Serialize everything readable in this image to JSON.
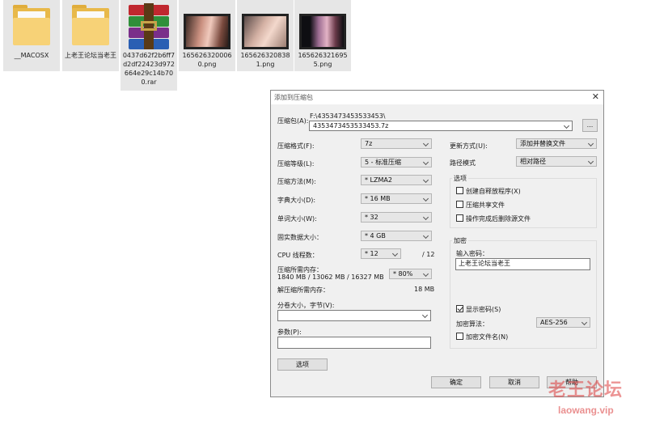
{
  "desktop": {
    "files": [
      {
        "name": "__MACOSX",
        "type": "folder-icon"
      },
      {
        "name": "上老王论坛当老王",
        "type": "folder-icon"
      },
      {
        "name": "0437d62f2b6ff7d2df22423d972664e29c14b700.rar",
        "type": "winrar-archive-icon"
      },
      {
        "name": "1656263200060.png",
        "type": "image-thumbnail"
      },
      {
        "name": "1656263208381.png",
        "type": "image-thumbnail"
      },
      {
        "name": "1656263216955.png",
        "type": "image-thumbnail"
      }
    ]
  },
  "dialog": {
    "title": "添加到压缩包",
    "close_glyph": "✕",
    "archive": {
      "label": "压缩包(A):",
      "path": "F:\\4353473453533453\\",
      "name": "4353473453533453.7z",
      "browse_label": "..."
    },
    "left": {
      "format": {
        "label": "压缩格式(F):",
        "value": "7z"
      },
      "level": {
        "label": "压缩等级(L):",
        "value": "5 - 标准压缩"
      },
      "method": {
        "label": "压缩方法(M):",
        "value": "* LZMA2"
      },
      "dict": {
        "label": "字典大小(D):",
        "value": "* 16 MB"
      },
      "word": {
        "label": "单词大小(W):",
        "value": "* 32"
      },
      "solid": {
        "label": "固实数据大小：",
        "value": "* 4 GB"
      },
      "cpu": {
        "label": "CPU 线程数：",
        "value": "* 12",
        "max": "/ 12"
      },
      "memory": {
        "label": "压缩所需内存：",
        "detail": "1840 MB / 13062 MB / 16327 MB",
        "percent": "* 80%"
      },
      "decomp": {
        "label": "解压缩所需内存：",
        "value": "18 MB"
      },
      "split": {
        "label": "分卷大小，字节(V):",
        "value": ""
      },
      "params": {
        "label": "参数(P):",
        "value": ""
      },
      "options_button": "选项"
    },
    "right": {
      "update": {
        "label": "更新方式(U):",
        "value": "添加并替换文件"
      },
      "pathmode": {
        "label": "路径模式",
        "value": "相对路径"
      },
      "options": {
        "title": "选项",
        "sfx": "创建自释放程序(X)",
        "shared": "压缩共享文件",
        "delete": "操作完成后删除源文件"
      },
      "encryption": {
        "title": "加密",
        "password_label": "输入密码：",
        "password_value": "上老王论坛当老王",
        "show_password": "显示密码(S)",
        "method_label": "加密算法：",
        "method_value": "AES-256",
        "encrypt_names": "加密文件名(N)"
      }
    },
    "buttons": {
      "ok": "确定",
      "cancel": "取消",
      "help": "帮助"
    }
  },
  "watermark": {
    "logo": "老王论坛",
    "url": "laowang.vip"
  }
}
